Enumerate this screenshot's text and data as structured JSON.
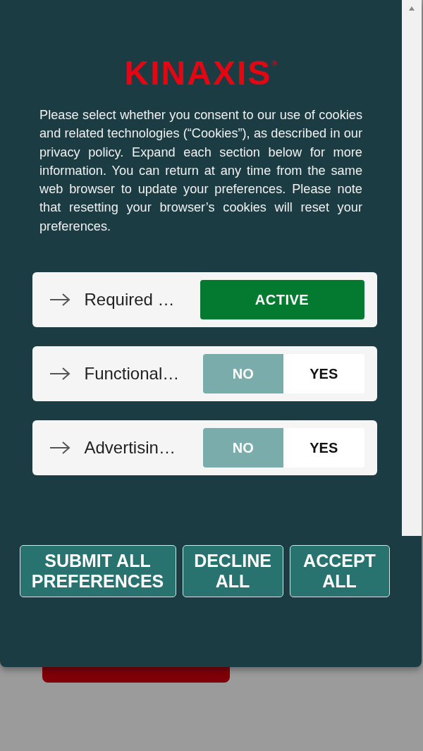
{
  "logo": {
    "text": "KINAXIS",
    "mark": "®"
  },
  "intro": "Please select whether you consent to our use of cookies and related technologies (“Cookies”), as described in our privacy policy. Expand each section below for more information. You can return at any time from the same web browser to update your preferences. Please note that resetting your browser’s cookies will reset your preferences.",
  "sections": [
    {
      "kind": "status",
      "label": "Required …",
      "status": "ACTIVE"
    },
    {
      "kind": "toggle",
      "label": "Functional…",
      "options": [
        {
          "label": "NO",
          "selected": true
        },
        {
          "label": "YES",
          "selected": false
        }
      ]
    },
    {
      "kind": "toggle",
      "label": "Advertisin…",
      "options": [
        {
          "label": "NO",
          "selected": true
        },
        {
          "label": "YES",
          "selected": false
        }
      ]
    }
  ],
  "buttons": [
    {
      "label": "SUBMIT ALL PREFERENCES"
    },
    {
      "label": "DECLINE ALL"
    },
    {
      "label": "ACCEPT ALL"
    }
  ]
}
